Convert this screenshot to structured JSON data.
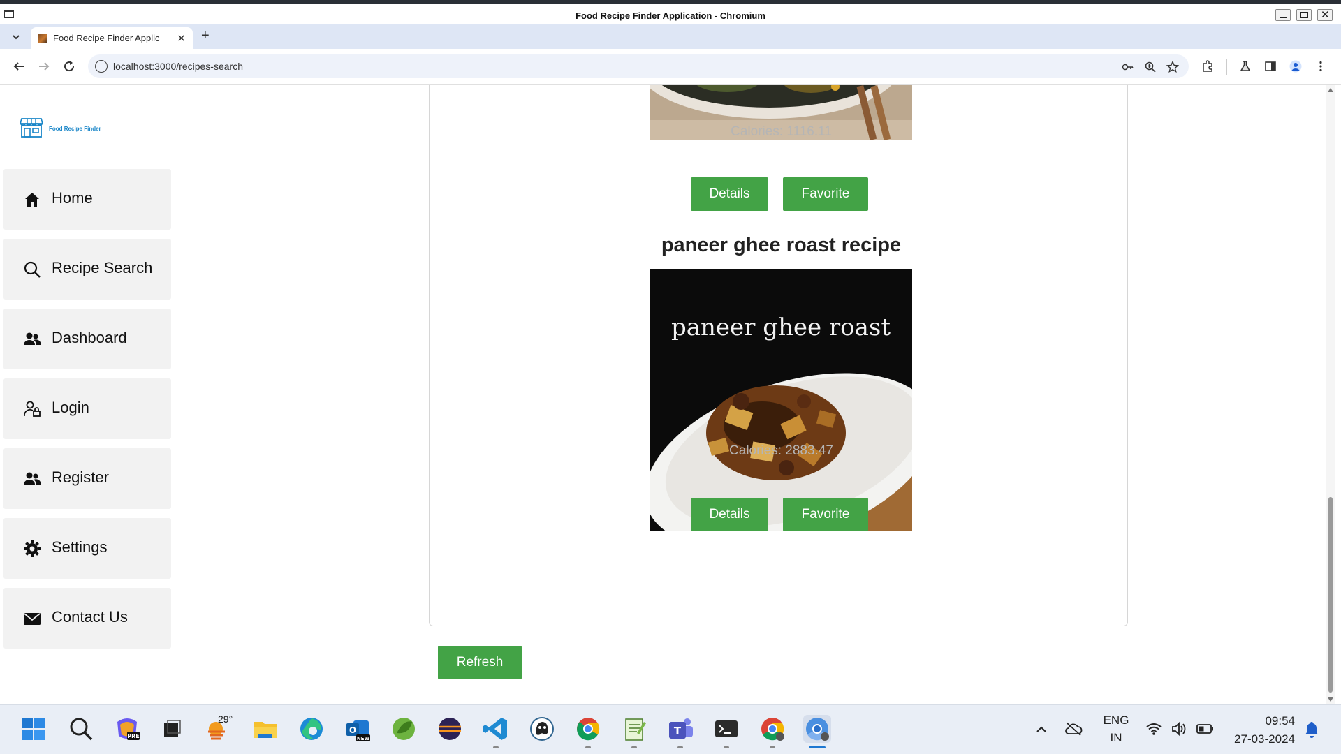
{
  "window": {
    "title": "Food Recipe Finder Application - Chromium"
  },
  "tab": {
    "title": "Food Recipe Finder Applic"
  },
  "address_bar": {
    "url": "localhost:3000/recipes-search"
  },
  "brand": {
    "name": "Food Recipe Finder"
  },
  "sidebar": {
    "items": [
      {
        "label": "Home",
        "icon": "home-icon"
      },
      {
        "label": "Recipe Search",
        "icon": "search-icon"
      },
      {
        "label": "Dashboard",
        "icon": "users-icon"
      },
      {
        "label": "Login",
        "icon": "user-lock-icon"
      },
      {
        "label": "Register",
        "icon": "users-icon"
      },
      {
        "label": "Settings",
        "icon": "gear-icon"
      },
      {
        "label": "Contact Us",
        "icon": "envelope-icon"
      }
    ]
  },
  "recipes": [
    {
      "title": "",
      "calories": "Calories: 1116.11",
      "details_label": "Details",
      "favorite_label": "Favorite"
    },
    {
      "title": "paneer ghee roast recipe",
      "image_caption": "paneer ghee roast",
      "calories": "Calories: 2883.47",
      "details_label": "Details",
      "favorite_label": "Favorite"
    }
  ],
  "refresh_label": "Refresh",
  "taskbar": {
    "weather_temp": "29°",
    "language": "ENG",
    "region": "IN",
    "time": "09:54",
    "date": "27-03-2024",
    "apps": [
      "start-icon",
      "search-icon",
      "copilot-icon",
      "task-view-icon",
      "weather-icon",
      "file-explorer-icon",
      "edge-icon",
      "outlook-icon",
      "spring-icon",
      "eclipse-icon",
      "vscode-icon",
      "pgadmin-icon",
      "chrome-icon",
      "notepad-icon",
      "teams-icon",
      "terminal-icon",
      "chrome-user-icon",
      "chromium-icon"
    ]
  },
  "colors": {
    "accent_green": "#43a346",
    "brand_blue": "#1a86c8",
    "calories_gray": "#b5b5b5",
    "nav_bg": "#f2f2f2"
  }
}
